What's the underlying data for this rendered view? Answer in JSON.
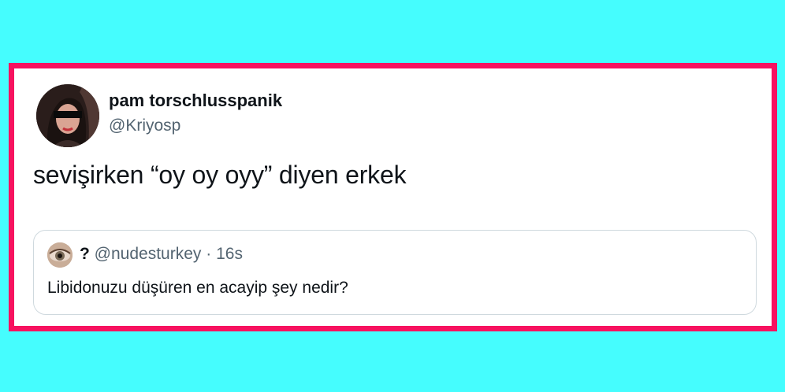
{
  "colors": {
    "background": "#45fdfe",
    "frame_border": "#f7125f",
    "card_background": "#ffffff",
    "text_primary": "#0f1419",
    "text_secondary": "#536471",
    "quote_border": "#cfd9de"
  },
  "tweet": {
    "author": {
      "display_name": "pam torschlusspanik",
      "handle": "@Kriyosp",
      "avatar_icon": "profile-photo"
    },
    "text": "sevişirken “oy oy oyy” diyen erkek",
    "quoted_tweet": {
      "author_name": "?",
      "author_handle": "@nudesturkey",
      "separator": "·",
      "time": "16s",
      "avatar_icon": "eye-photo",
      "text": "Libidonuzu düşüren en acayip şey nedir?"
    }
  }
}
